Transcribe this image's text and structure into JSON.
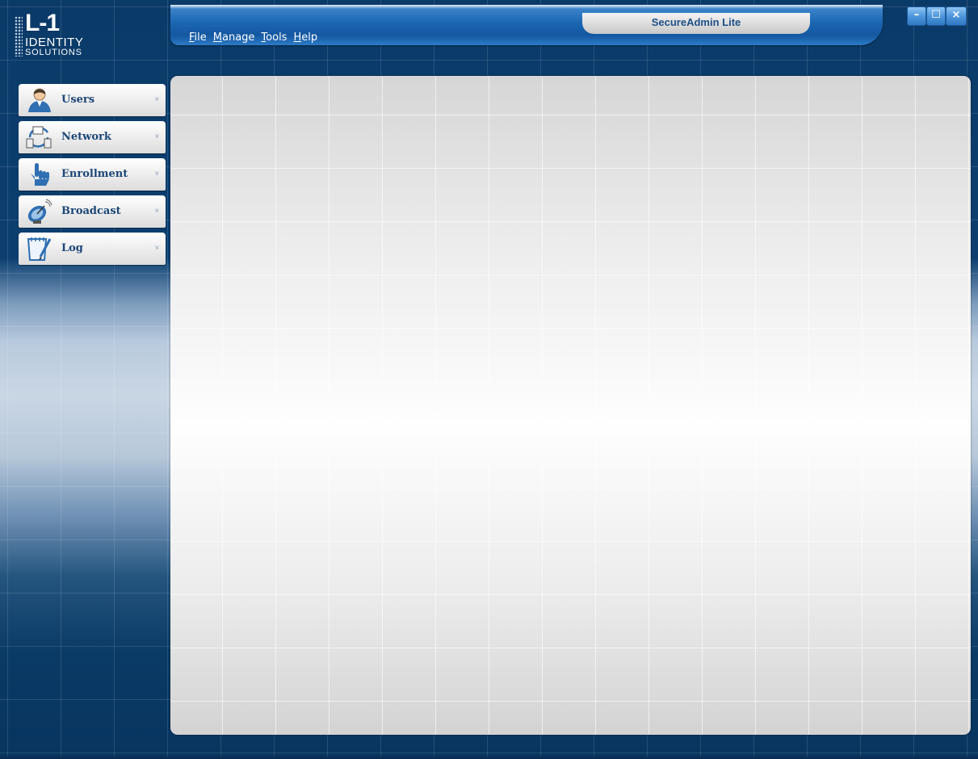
{
  "app": {
    "title": "SecureAdmin Lite"
  },
  "logo": {
    "mark": "L-1",
    "line1": "IDENTITY",
    "line2": "SOLUTIONS"
  },
  "menu": {
    "items": [
      {
        "accel": "F",
        "rest": "ile"
      },
      {
        "accel": "M",
        "rest": "anage"
      },
      {
        "accel": "T",
        "rest": "ools"
      },
      {
        "accel": "H",
        "rest": "elp"
      }
    ]
  },
  "window_controls": {
    "minimize": "–",
    "maximize": "☐",
    "close": "×"
  },
  "sidebar": {
    "chevron": "»",
    "items": [
      {
        "label": "Users",
        "icon": "user-icon"
      },
      {
        "label": "Network",
        "icon": "network-icon"
      },
      {
        "label": "Enrollment",
        "icon": "hand-pointer-icon"
      },
      {
        "label": "Broadcast",
        "icon": "satellite-dish-icon"
      },
      {
        "label": "Log",
        "icon": "notepad-icon"
      }
    ]
  },
  "colors": {
    "background": "#0b3a66",
    "titlebar": "#1b66b1",
    "label": "#1c4677"
  }
}
